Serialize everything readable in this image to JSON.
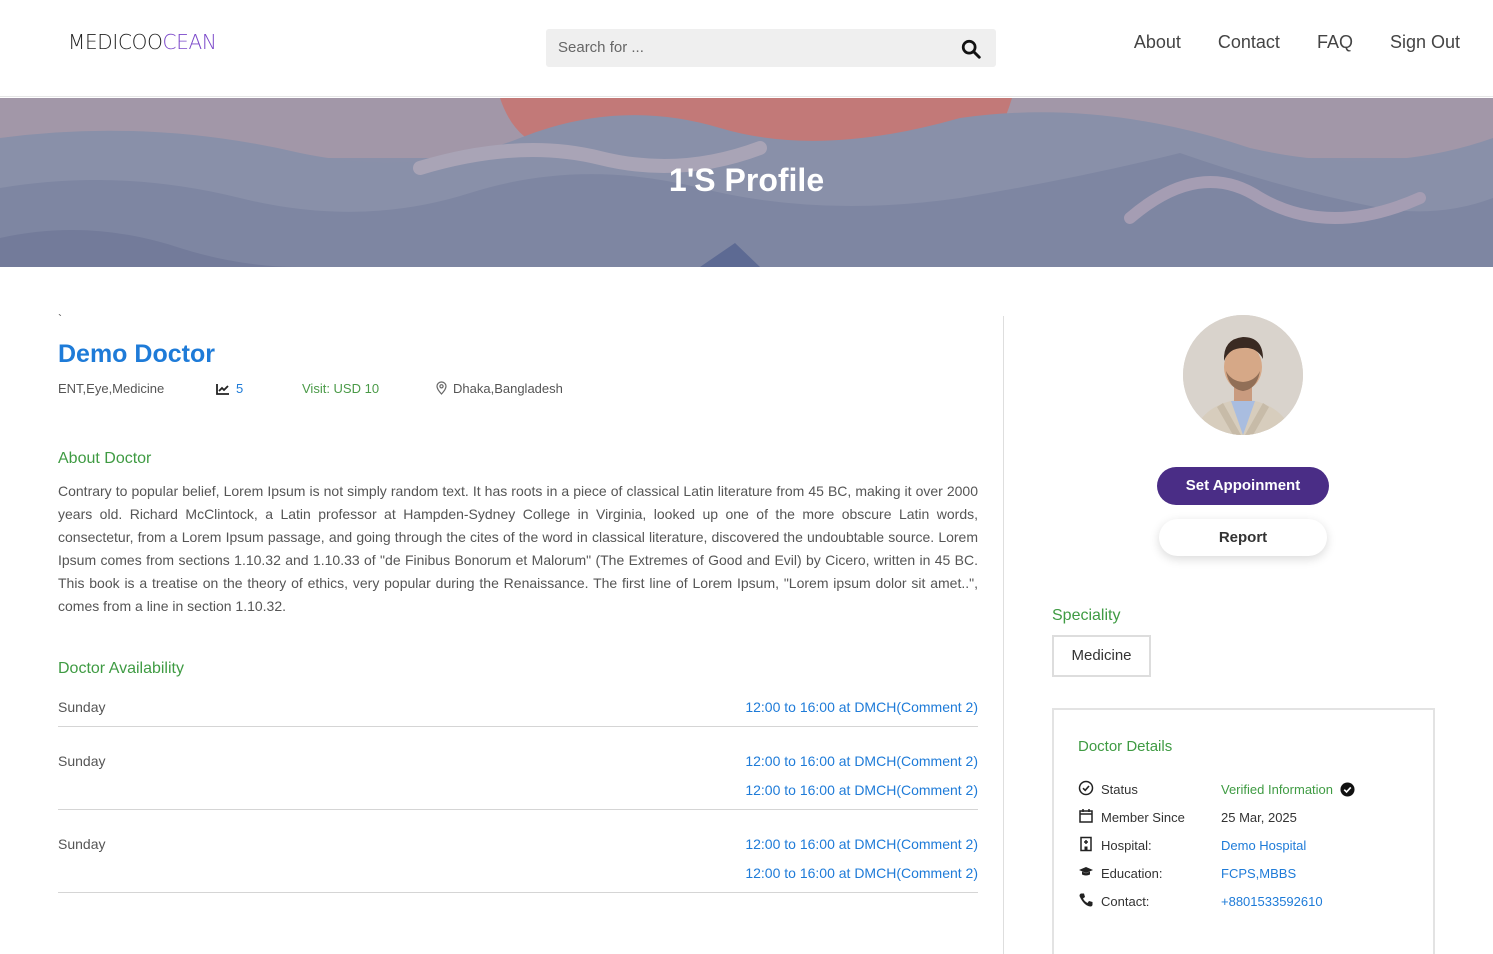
{
  "header": {
    "logo_part1": "MEDICOO",
    "logo_part2": "CEAN",
    "search_placeholder": "Search for ...",
    "nav": [
      "About",
      "Contact",
      "FAQ",
      "Sign Out"
    ]
  },
  "banner": {
    "title": "1'S Profile"
  },
  "doctor": {
    "backtick": "`",
    "name": "Demo Doctor",
    "specialities": "ENT,Eye,Medicine",
    "rating": "5",
    "visit": "Visit: USD 10",
    "location": "Dhaka,Bangladesh"
  },
  "about": {
    "title": "About Doctor",
    "text": "Contrary to popular belief, Lorem Ipsum is not simply random text. It has roots in a piece of classical Latin literature from 45 BC, making it over 2000 years old. Richard McClintock, a Latin professor at Hampden-Sydney College in Virginia, looked up one of the more obscure Latin words, consectetur, from a Lorem Ipsum passage, and going through the cites of the word in classical literature, discovered the undoubtable source. Lorem Ipsum comes from sections 1.10.32 and 1.10.33 of \"de Finibus Bonorum et Malorum\" (The Extremes of Good and Evil) by Cicero, written in 45 BC. This book is a treatise on the theory of ethics, very popular during the Renaissance. The first line of Lorem Ipsum, \"Lorem ipsum dolor sit amet..\", comes from a line in section 1.10.32."
  },
  "availability": {
    "title": "Doctor Availability",
    "rows": [
      {
        "day": "Sunday",
        "slots": [
          "12:00 to 16:00 at DMCH(Comment 2)"
        ]
      },
      {
        "day": "Sunday",
        "slots": [
          "12:00 to 16:00 at DMCH(Comment 2)",
          "12:00 to 16:00 at DMCH(Comment 2)"
        ]
      },
      {
        "day": "Sunday",
        "slots": [
          "12:00 to 16:00 at DMCH(Comment 2)",
          "12:00 to 16:00 at DMCH(Comment 2)"
        ]
      }
    ]
  },
  "sidebar": {
    "appoint_label": "Set Appoinment",
    "report_label": "Report",
    "speciality_title": "Speciality",
    "speciality": "Medicine",
    "details_title": "Doctor Details",
    "details": {
      "status_label": "Status",
      "status_value": "Verified Information",
      "member_label": "Member Since",
      "member_value": "25 Mar, 2025",
      "hospital_label": "Hospital:",
      "hospital_value": "Demo Hospital",
      "education_label": "Education:",
      "education_value": "FCPS,MBBS",
      "contact_label": "Contact:",
      "contact_value": "+8801533592610"
    }
  },
  "colors": {
    "brand_purple": "#4a2d86",
    "link_blue": "#1e7bd8",
    "section_green": "#3f9b43"
  }
}
